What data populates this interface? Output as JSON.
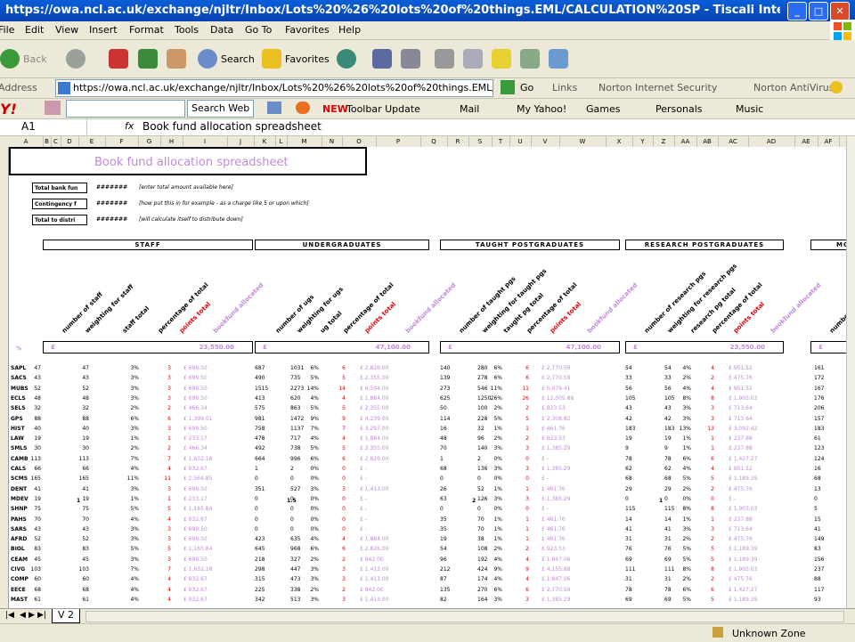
{
  "window": {
    "title": "https://owa.ncl.ac.uk/exchange/njltr/Inbox/Lots%20%26%20lots%20of%20things.EML/CALCULATION%20SP - Tiscali Internet Access"
  },
  "menu": [
    "File",
    "Edit",
    "View",
    "Insert",
    "Format",
    "Tools",
    "Data",
    "Go To",
    "Favorites",
    "Help"
  ],
  "toolbar": {
    "back": "Back",
    "search": "Search",
    "favorites": "Favorites"
  },
  "address": {
    "label": "Address",
    "value": "https://owa.ncl.ac.uk/exchange/njltr/Inbox/Lots%20%26%20lots%20of%20things.EML/CALCULAT",
    "go": "Go",
    "links": "Links",
    "norton": "Norton Internet Security",
    "antivirus": "Norton AntiVirus"
  },
  "yahoo": {
    "search_web": "Search Web",
    "toolbar_update": "Toolbar Update",
    "new": "NEW",
    "mail": "Mail",
    "my_yahoo": "My Yahoo!",
    "games": "Games",
    "personals": "Personals",
    "music": "Music"
  },
  "formula": {
    "cell": "A1",
    "fx": "fx",
    "content": "Book fund allocation spreadsheet"
  },
  "columns": [
    "A",
    "B",
    "C",
    "D",
    "E",
    "F",
    "G",
    "H",
    "I",
    "J",
    "K",
    "L",
    "M",
    "N",
    "O",
    "P",
    "Q",
    "R",
    "S",
    "T",
    "U",
    "V",
    "W",
    "X",
    "Y",
    "Z",
    "AA",
    "AB",
    "AC",
    "AD",
    "AE",
    "AF"
  ],
  "sheet": {
    "title": "Book fund allocation spreadsheet",
    "box1": "Total bank fun",
    "box2": "Contingency f",
    "box3": "Total to distri",
    "masked": "#######",
    "note1": "[enter total amount available here]",
    "note2": "[how put this in for example - as a charge like 5 or upon which]",
    "note3": "[will calculate itself to distribute down]",
    "groups": [
      "STAFF",
      "UNDERGRADUATES",
      "TAUGHT POSTGRADUATES",
      "RESEARCH POSTGRADUATES",
      "MO"
    ],
    "headers_staff": [
      "number of staff",
      "weighting for staff",
      "staff total",
      "percentage of total",
      "points total",
      "bookfund allocated"
    ],
    "headers_ug": [
      "number of ugs",
      "weighting for ugs",
      "ug total",
      "percentage of total",
      "points total",
      "bookfund allocated"
    ],
    "headers_tpg": [
      "number of taught pgs",
      "weighting for taught pgs",
      "taught pg total",
      "percentage of total",
      "points total",
      "bookfund allocated"
    ],
    "headers_rpg": [
      "number of research pgs",
      "weighting for research pgs",
      "research pg total",
      "percentage of total",
      "points total",
      "bookfund allocated"
    ],
    "header_more": "numbe",
    "totals": [
      "£",
      "23,550.00",
      "£",
      "47,100.00",
      "£",
      "47,100.00",
      "£",
      "23,550.00",
      "£"
    ],
    "percent_label": "%",
    "weights": {
      "staff": "1",
      "ug": "1.5",
      "tpg": "2",
      "rpg": "1"
    },
    "rows": [
      {
        "code": "SAPL",
        "staff": [
          "47",
          "47",
          "3%",
          "3",
          "£  699.50"
        ],
        "ug": [
          "687",
          "1031",
          "6%",
          "6",
          "£  2,826.00"
        ],
        "tpg": [
          "140",
          "280",
          "6%",
          "6",
          "£  2,770.59"
        ],
        "rpg": [
          "54",
          "54",
          "4%",
          "4",
          "£  951.52"
        ],
        "more": "161"
      },
      {
        "code": "SACS",
        "staff": [
          "43",
          "43",
          "3%",
          "3",
          "£  699.50"
        ],
        "ug": [
          "490",
          "735",
          "5%",
          "5",
          "£  2,355.00"
        ],
        "tpg": [
          "139",
          "278",
          "6%",
          "6",
          "£  2,770.59"
        ],
        "rpg": [
          "33",
          "33",
          "2%",
          "2",
          "£  475.76"
        ],
        "more": "172"
      },
      {
        "code": "MUBS",
        "staff": [
          "52",
          "52",
          "3%",
          "3",
          "£  699.50"
        ],
        "ug": [
          "1515",
          "2273",
          "14%",
          "14",
          "£  6,594.00"
        ],
        "tpg": [
          "273",
          "546",
          "11%",
          "11",
          "£  5,079.41"
        ],
        "rpg": [
          "56",
          "56",
          "4%",
          "4",
          "£  951.52"
        ],
        "more": "167"
      },
      {
        "code": "ECLS",
        "staff": [
          "48",
          "48",
          "3%",
          "3",
          "£  699.50"
        ],
        "ug": [
          "413",
          "620",
          "4%",
          "4",
          "£  1,884.00"
        ],
        "tpg": [
          "625",
          "1250",
          "26%",
          "26",
          "£  12,005.88"
        ],
        "rpg": [
          "105",
          "105",
          "8%",
          "8",
          "£  1,903.03"
        ],
        "more": "176"
      },
      {
        "code": "SELS",
        "staff": [
          "32",
          "32",
          "2%",
          "2",
          "£  466.34"
        ],
        "ug": [
          "575",
          "863",
          "5%",
          "5",
          "£  2,355.00"
        ],
        "tpg": [
          "50",
          "100",
          "2%",
          "2",
          "£  923.53"
        ],
        "rpg": [
          "43",
          "43",
          "3%",
          "3",
          "£  713.64"
        ],
        "more": "206"
      },
      {
        "code": "GPS",
        "staff": [
          "88",
          "88",
          "6%",
          "6",
          "£  1,399.01"
        ],
        "ug": [
          "981",
          "1472",
          "9%",
          "9",
          "£  4,239.00"
        ],
        "tpg": [
          "114",
          "228",
          "5%",
          "5",
          "£  2,308.82"
        ],
        "rpg": [
          "42",
          "42",
          "3%",
          "3",
          "£  713.64"
        ],
        "more": "157"
      },
      {
        "code": "HIST",
        "staff": [
          "40",
          "40",
          "3%",
          "3",
          "£  699.50"
        ],
        "ug": [
          "758",
          "1137",
          "7%",
          "7",
          "£  3,297.00"
        ],
        "tpg": [
          "16",
          "32",
          "1%",
          "1",
          "£  461.76"
        ],
        "rpg": [
          "183",
          "183",
          "13%",
          "13",
          "£  3,092.42"
        ],
        "more": "183"
      },
      {
        "code": "LAW",
        "staff": [
          "19",
          "19",
          "1%",
          "1",
          "£  233.17"
        ],
        "ug": [
          "478",
          "717",
          "4%",
          "4",
          "£  1,884.00"
        ],
        "tpg": [
          "48",
          "96",
          "2%",
          "2",
          "£  923.53"
        ],
        "rpg": [
          "19",
          "19",
          "1%",
          "1",
          "£  237.88"
        ],
        "more": "61"
      },
      {
        "code": "SMLS",
        "staff": [
          "30",
          "30",
          "2%",
          "2",
          "£  466.34"
        ],
        "ug": [
          "492",
          "738",
          "5%",
          "5",
          "£  2,355.00"
        ],
        "tpg": [
          "70",
          "140",
          "3%",
          "3",
          "£  1,385.29"
        ],
        "rpg": [
          "9",
          "9",
          "1%",
          "1",
          "£  237.88"
        ],
        "more": "123"
      },
      {
        "code": "CAMB",
        "staff": [
          "113",
          "113",
          "7%",
          "7",
          "£  1,632.18"
        ],
        "ug": [
          "664",
          "996",
          "6%",
          "6",
          "£  2,826.00"
        ],
        "tpg": [
          "1",
          "2",
          "0%",
          "0",
          "£  -"
        ],
        "rpg": [
          "78",
          "78",
          "6%",
          "6",
          "£  1,427.27"
        ],
        "more": "124"
      },
      {
        "code": "CALS",
        "staff": [
          "66",
          "66",
          "4%",
          "4",
          "£  932.67"
        ],
        "ug": [
          "1",
          "2",
          "0%",
          "0",
          "£  -"
        ],
        "tpg": [
          "68",
          "136",
          "3%",
          "3",
          "£  1,385.29"
        ],
        "rpg": [
          "62",
          "62",
          "4%",
          "4",
          "£  951.52"
        ],
        "more": "16"
      },
      {
        "code": "SCMS",
        "staff": [
          "165",
          "165",
          "11%",
          "11",
          "£  2,564.85"
        ],
        "ug": [
          "0",
          "0",
          "0%",
          "0",
          "£  -"
        ],
        "tpg": [
          "0",
          "0",
          "0%",
          "0",
          "£  -"
        ],
        "rpg": [
          "68",
          "68",
          "5%",
          "5",
          "£  1,189.39"
        ],
        "more": "68"
      },
      {
        "code": "DENT",
        "staff": [
          "41",
          "41",
          "3%",
          "3",
          "£  699.50"
        ],
        "ug": [
          "351",
          "527",
          "3%",
          "3",
          "£  1,413.00"
        ],
        "tpg": [
          "26",
          "52",
          "1%",
          "1",
          "£  461.76"
        ],
        "rpg": [
          "29",
          "29",
          "2%",
          "2",
          "£  475.76"
        ],
        "more": "13"
      },
      {
        "code": "MDEV",
        "staff": [
          "19",
          "19",
          "1%",
          "1",
          "£  233.17"
        ],
        "ug": [
          "0",
          "0",
          "0%",
          "0",
          "£  -"
        ],
        "tpg": [
          "63",
          "126",
          "3%",
          "3",
          "£  1,385.29"
        ],
        "rpg": [
          "0",
          "0",
          "0%",
          "0",
          "£  -"
        ],
        "more": "0"
      },
      {
        "code": "SHNP",
        "staff": [
          "75",
          "75",
          "5%",
          "5",
          "£  1,165.84"
        ],
        "ug": [
          "0",
          "0",
          "0%",
          "0",
          "£  -"
        ],
        "tpg": [
          "0",
          "0",
          "0%",
          "0",
          "£  -"
        ],
        "rpg": [
          "115",
          "115",
          "8%",
          "8",
          "£  1,903.03"
        ],
        "more": "5"
      },
      {
        "code": "PAHS",
        "staff": [
          "70",
          "70",
          "4%",
          "4",
          "£  932.67"
        ],
        "ug": [
          "0",
          "0",
          "0%",
          "0",
          "£  -"
        ],
        "tpg": [
          "35",
          "70",
          "1%",
          "1",
          "£  461.76"
        ],
        "rpg": [
          "14",
          "14",
          "1%",
          "1",
          "£  237.88"
        ],
        "more": "15"
      },
      {
        "code": "SARS",
        "staff": [
          "43",
          "43",
          "3%",
          "3",
          "£  699.50"
        ],
        "ug": [
          "0",
          "0",
          "0%",
          "0",
          "£  -"
        ],
        "tpg": [
          "35",
          "70",
          "1%",
          "1",
          "£  461.76"
        ],
        "rpg": [
          "41",
          "41",
          "3%",
          "3",
          "£  713.64"
        ],
        "more": "41"
      },
      {
        "code": "AFRD",
        "staff": [
          "52",
          "52",
          "3%",
          "3",
          "£  699.50"
        ],
        "ug": [
          "423",
          "635",
          "4%",
          "4",
          "£  1,884.00"
        ],
        "tpg": [
          "19",
          "38",
          "1%",
          "1",
          "£  461.76"
        ],
        "rpg": [
          "31",
          "31",
          "2%",
          "2",
          "£  475.76"
        ],
        "more": "149"
      },
      {
        "code": "BIOL",
        "staff": [
          "83",
          "83",
          "5%",
          "5",
          "£  1,165.84"
        ],
        "ug": [
          "645",
          "968",
          "6%",
          "6",
          "£  2,826.00"
        ],
        "tpg": [
          "54",
          "108",
          "2%",
          "2",
          "£  923.53"
        ],
        "rpg": [
          "76",
          "76",
          "5%",
          "5",
          "£  1,189.39"
        ],
        "more": "83"
      },
      {
        "code": "CEAM",
        "staff": [
          "45",
          "45",
          "3%",
          "3",
          "£  699.50"
        ],
        "ug": [
          "218",
          "327",
          "2%",
          "2",
          "£  942.00"
        ],
        "tpg": [
          "96",
          "192",
          "4%",
          "4",
          "£  1,847.06"
        ],
        "rpg": [
          "69",
          "69",
          "5%",
          "5",
          "£  1,189.39"
        ],
        "more": "156"
      },
      {
        "code": "CIVG",
        "staff": [
          "103",
          "103",
          "7%",
          "7",
          "£  1,632.18"
        ],
        "ug": [
          "298",
          "447",
          "3%",
          "3",
          "£  1,413.00"
        ],
        "tpg": [
          "212",
          "424",
          "9%",
          "9",
          "£  4,155.88"
        ],
        "rpg": [
          "111",
          "111",
          "8%",
          "8",
          "£  1,903.03"
        ],
        "more": "237"
      },
      {
        "code": "COMP",
        "staff": [
          "60",
          "60",
          "4%",
          "4",
          "£  932.67"
        ],
        "ug": [
          "315",
          "473",
          "3%",
          "3",
          "£  1,413.00"
        ],
        "tpg": [
          "87",
          "174",
          "4%",
          "4",
          "£  1,847.06"
        ],
        "rpg": [
          "31",
          "31",
          "2%",
          "2",
          "£  475.76"
        ],
        "more": "88"
      },
      {
        "code": "EECE",
        "staff": [
          "68",
          "68",
          "4%",
          "4",
          "£  932.67"
        ],
        "ug": [
          "225",
          "338",
          "2%",
          "2",
          "£  942.00"
        ],
        "tpg": [
          "135",
          "270",
          "6%",
          "6",
          "£  2,770.59"
        ],
        "rpg": [
          "78",
          "78",
          "6%",
          "6",
          "£  1,427.27"
        ],
        "more": "117"
      },
      {
        "code": "MAST",
        "staff": [
          "61",
          "61",
          "4%",
          "4",
          "£  932.67"
        ],
        "ug": [
          "342",
          "513",
          "3%",
          "3",
          "£  1,413.00"
        ],
        "tpg": [
          "82",
          "164",
          "3%",
          "3",
          "£  1,385.29"
        ],
        "rpg": [
          "69",
          "69",
          "5%",
          "5",
          "£  1,189.39"
        ],
        "more": "93"
      }
    ]
  },
  "tabs": {
    "sheet": "V 2"
  },
  "status": {
    "zone": "Unknown Zone"
  }
}
